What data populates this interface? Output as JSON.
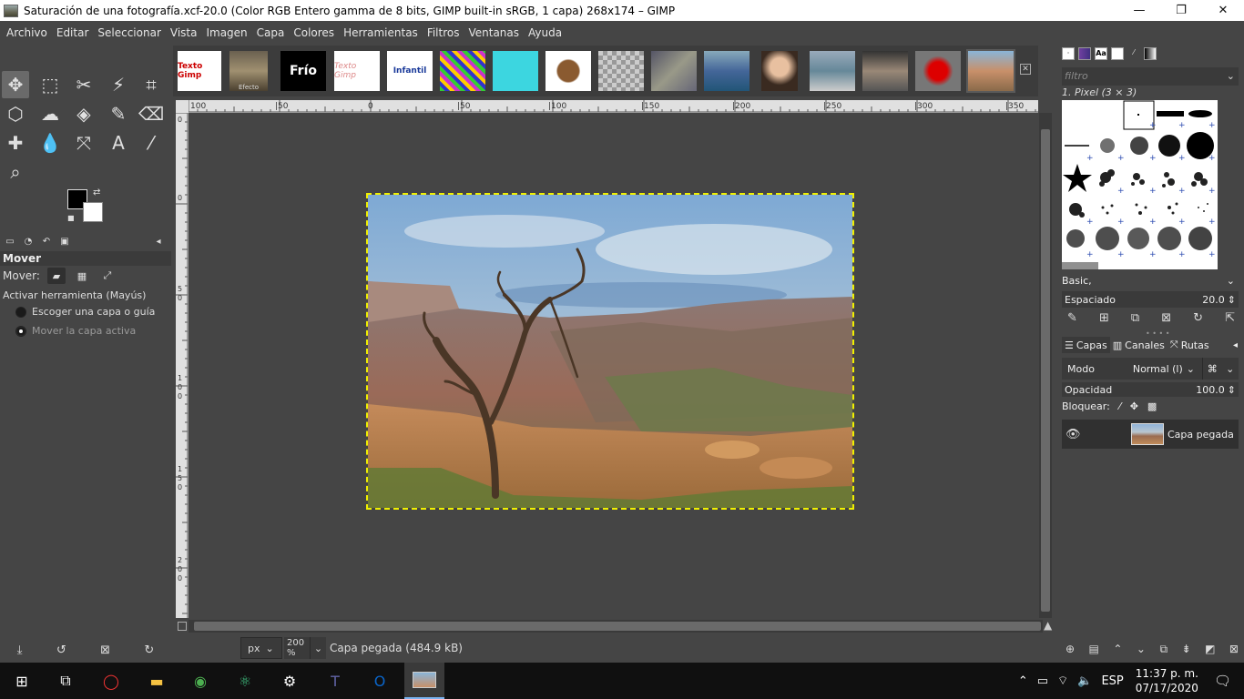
{
  "window": {
    "title": "Saturación de una fotografía.xcf-20.0 (Color RGB Entero gamma de 8 bits, GIMP built-in sRGB, 1 capa) 268x174 – GIMP",
    "minimize": "—",
    "maximize": "❐",
    "close": "✕"
  },
  "menu": [
    "Archivo",
    "Editar",
    "Seleccionar",
    "Vista",
    "Imagen",
    "Capa",
    "Colores",
    "Herramientas",
    "Filtros",
    "Ventanas",
    "Ayuda"
  ],
  "image_tabs": [
    "Texto Gimp",
    "Efecto",
    "Frío",
    "Texto Gimp",
    "Infantil"
  ],
  "tool_options": {
    "title": "Mover",
    "mover_label": "Mover:",
    "toggle_label": "Activar herramienta  (Mayús)",
    "option_pick": "Escoger una capa o guía",
    "option_active": "Mover la capa activa"
  },
  "ruler": {
    "h_ticks": [
      "100",
      "|50",
      "0",
      "|50",
      "|100",
      "|150",
      "|200",
      "|250",
      "|300",
      "|350"
    ],
    "v_ticks": [
      "0",
      "0",
      "5\n0",
      "1\n0\n0",
      "1\n5\n0",
      "2\n0\n0"
    ]
  },
  "status": {
    "unit": "px",
    "zoom": "200 %",
    "layer_info": "Capa pegada (484.9 kB)"
  },
  "brushes": {
    "filter_placeholder": "filtro",
    "selected_name": "1. Pixel (3 × 3)",
    "preset": "Basic,",
    "spacing_label": "Espaciado",
    "spacing_value": "20.0"
  },
  "layers": {
    "tabs": [
      "Capas",
      "Canales",
      "Rutas"
    ],
    "mode_label": "Modo",
    "mode_value": "Normal (l)",
    "opacity_label": "Opacidad",
    "opacity_value": "100.0",
    "lock_label": "Bloquear:",
    "layer_name": "Capa pegada"
  },
  "taskbar": {
    "language": "ESP",
    "time": "11:37 p. m.",
    "date": "07/17/2020"
  }
}
